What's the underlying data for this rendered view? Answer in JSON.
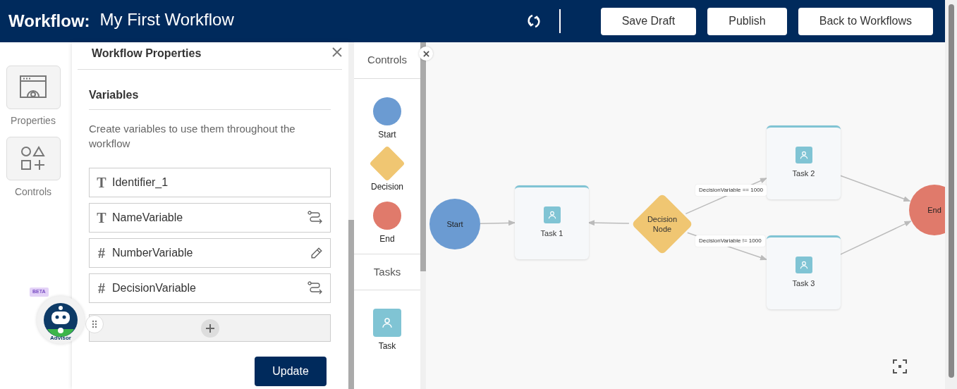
{
  "header": {
    "label": "Workflow:",
    "title": "My First Workflow",
    "buttons": [
      "Save Draft",
      "Publish",
      "Back to Workflows"
    ]
  },
  "rail": [
    {
      "kind": "properties",
      "label": "Properties"
    },
    {
      "kind": "controls",
      "label": "Controls"
    }
  ],
  "properties_panel": {
    "title": "Workflow Properties",
    "section": "Variables",
    "description": "Create variables to use them throughout the workflow",
    "variables": [
      {
        "icon": "T",
        "name": "Identifier_1"
      },
      {
        "icon": "T",
        "name": "NameVariable",
        "kind": "route"
      },
      {
        "icon": "#",
        "name": "NumberVariable",
        "kind": "edit"
      },
      {
        "icon": "#",
        "name": "DecisionVariable",
        "kind": "route"
      }
    ],
    "button": "Update"
  },
  "advisor": {
    "badge": "BETA",
    "label": "Advisor"
  },
  "palette": {
    "sections": [
      {
        "title": "Controls",
        "items": [
          {
            "kind": "start",
            "label": "Start"
          },
          {
            "kind": "decision",
            "label": "Decision"
          },
          {
            "kind": "end",
            "label": "End"
          }
        ]
      },
      {
        "title": "Tasks",
        "items": [
          {
            "kind": "task",
            "label": "Task"
          }
        ]
      }
    ]
  },
  "canvas": {
    "nodes": [
      {
        "kind": "start",
        "label": "Start"
      },
      {
        "kind": "task",
        "label": "Task 1"
      },
      {
        "kind": "decision",
        "label": "Decision Node"
      },
      {
        "kind": "task",
        "label": "Task 2"
      },
      {
        "kind": "task",
        "label": "Task 3"
      },
      {
        "kind": "end",
        "label": "End"
      }
    ],
    "conditions": [
      "DecisionVariable == 1000",
      "DecisionVariable != 1000"
    ]
  }
}
